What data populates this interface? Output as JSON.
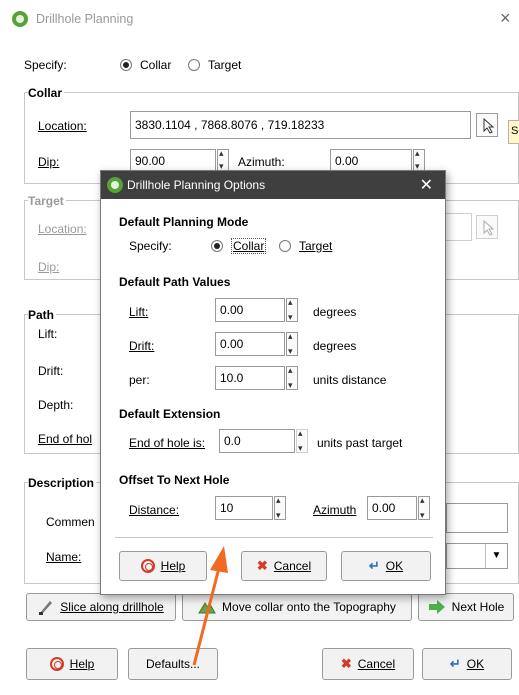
{
  "window": {
    "title": "Drillhole Planning",
    "close": "×"
  },
  "specify": {
    "label": "Specify:",
    "options": [
      "Collar",
      "Target"
    ],
    "selected": "Collar"
  },
  "collar": {
    "title": "Collar",
    "location_label": "Location:",
    "location_value": "3830.1104        , 7868.8076        , 719.18233",
    "dip_label": "Dip:",
    "dip_value": "90.00",
    "azimuth_label": "Azimuth:",
    "azimuth_value": "0.00",
    "tooltip": "Se"
  },
  "target": {
    "title": "Target",
    "location_label": "Location:",
    "dip_label": "Dip:"
  },
  "path": {
    "title": "Path",
    "lift_label": "Lift:",
    "drift_label": "Drift:",
    "depth_label": "Depth:",
    "end_label": "End of hol"
  },
  "description": {
    "title": "Description",
    "comment_label": "Commen",
    "name_label": "Name:"
  },
  "buttons": {
    "slice": "Slice along drillhole",
    "move_collar": "Move collar onto the Topography",
    "next_hole": "Next Hole",
    "help": "Help",
    "defaults": "Defaults...",
    "cancel": "Cancel",
    "ok": "OK"
  },
  "dialog": {
    "title": "Drillhole Planning Options",
    "close": "✕",
    "planning_mode_title": "Default Planning Mode",
    "specify_label": "Specify:",
    "mode_options": [
      "Collar",
      "Target"
    ],
    "mode_selected": "Collar",
    "path_values_title": "Default Path Values",
    "lift_label": "Lift:",
    "lift_value": "0.00",
    "lift_unit": "degrees",
    "drift_label": "Drift:",
    "drift_value": "0.00",
    "drift_unit": "degrees",
    "per_label": "per:",
    "per_value": "10.0",
    "per_unit": "units distance",
    "extension_title": "Default Extension",
    "end_label": "End of hole is:",
    "end_value": "0.0",
    "end_unit": "units past target",
    "offset_title": "Offset To Next Hole",
    "distance_label": "Distance:",
    "distance_value": "10",
    "azimuth_label": "Azimuth",
    "azimuth_value": "0.00",
    "help": "Help",
    "cancel": "Cancel",
    "ok": "OK"
  },
  "colors": {
    "arrow": "#f06a22",
    "dialog_title_bg": "#3f3f3f",
    "app_icon": "#56a337"
  }
}
